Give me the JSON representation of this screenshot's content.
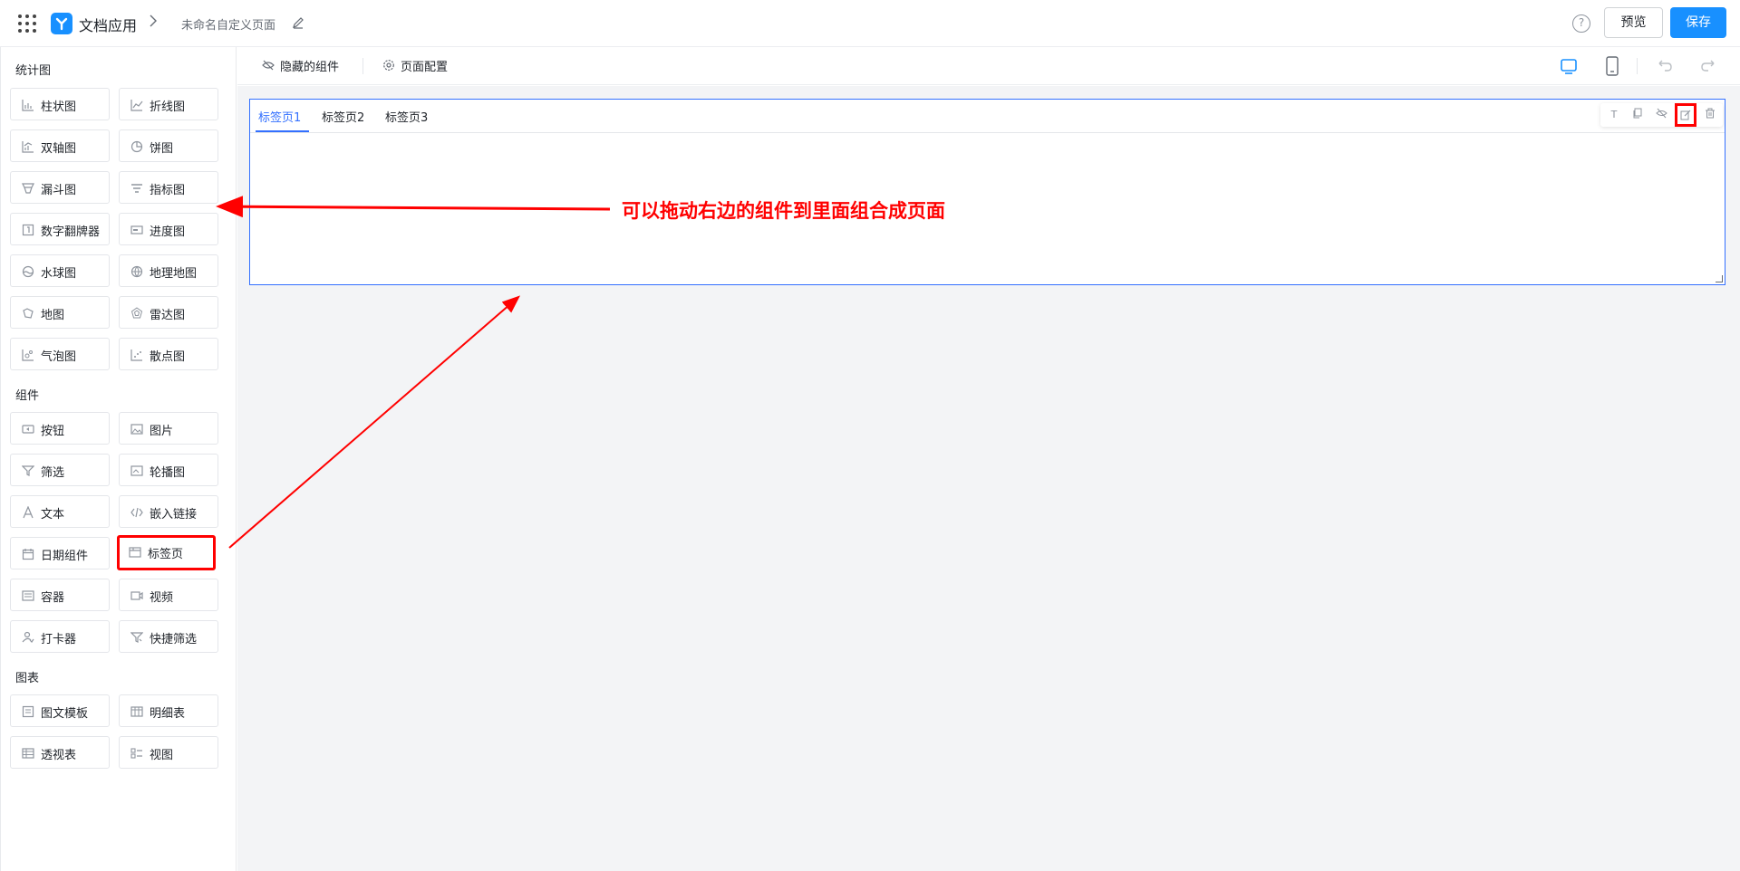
{
  "header": {
    "app_title": "文档应用",
    "page_name": "未命名自定义页面",
    "help_label": "?",
    "preview_label": "预览",
    "save_label": "保存",
    "brand_color": "#1890ff"
  },
  "sidebar": {
    "sections": [
      {
        "title": "统计图",
        "items": [
          {
            "label": "柱状图",
            "icon": "bar-chart-icon"
          },
          {
            "label": "折线图",
            "icon": "line-chart-icon"
          },
          {
            "label": "双轴图",
            "icon": "dual-axis-icon"
          },
          {
            "label": "饼图",
            "icon": "pie-chart-icon"
          },
          {
            "label": "漏斗图",
            "icon": "funnel-icon"
          },
          {
            "label": "指标图",
            "icon": "indicator-icon"
          },
          {
            "label": "数字翻牌器",
            "icon": "number-flip-icon"
          },
          {
            "label": "进度图",
            "icon": "progress-icon"
          },
          {
            "label": "水球图",
            "icon": "liquid-icon"
          },
          {
            "label": "地理地图",
            "icon": "globe-icon"
          },
          {
            "label": "地图",
            "icon": "map-icon"
          },
          {
            "label": "雷达图",
            "icon": "radar-icon"
          },
          {
            "label": "气泡图",
            "icon": "bubble-icon"
          },
          {
            "label": "散点图",
            "icon": "scatter-icon"
          }
        ]
      },
      {
        "title": "组件",
        "items": [
          {
            "label": "按钮",
            "icon": "button-icon"
          },
          {
            "label": "图片",
            "icon": "image-icon"
          },
          {
            "label": "筛选",
            "icon": "filter-icon"
          },
          {
            "label": "轮播图",
            "icon": "carousel-icon"
          },
          {
            "label": "文本",
            "icon": "text-icon"
          },
          {
            "label": "嵌入链接",
            "icon": "code-icon"
          },
          {
            "label": "日期组件",
            "icon": "calendar-icon"
          },
          {
            "label": "标签页",
            "icon": "tabs-icon",
            "highlighted": true
          },
          {
            "label": "容器",
            "icon": "container-icon"
          },
          {
            "label": "视频",
            "icon": "video-icon"
          },
          {
            "label": "打卡器",
            "icon": "checkin-icon"
          },
          {
            "label": "快捷筛选",
            "icon": "quick-filter-icon"
          }
        ]
      },
      {
        "title": "图表",
        "items": [
          {
            "label": "图文模板",
            "icon": "template-icon"
          },
          {
            "label": "明细表",
            "icon": "detail-table-icon"
          },
          {
            "label": "透视表",
            "icon": "pivot-table-icon"
          },
          {
            "label": "视图",
            "icon": "view-icon"
          }
        ]
      }
    ]
  },
  "toolbar": {
    "hidden_components_label": "隐藏的组件",
    "page_config_label": "页面配置",
    "active_device": "desktop"
  },
  "canvas": {
    "tabs": [
      {
        "label": "标签页1",
        "active": true
      },
      {
        "label": "标签页2",
        "active": false
      },
      {
        "label": "标签页3",
        "active": false
      }
    ],
    "component_tools": [
      {
        "icon": "text-icon",
        "glyph": "T"
      },
      {
        "icon": "copy-icon"
      },
      {
        "icon": "hide-icon"
      },
      {
        "icon": "edit-icon",
        "highlighted": true
      },
      {
        "icon": "delete-icon"
      }
    ],
    "accent_color": "#3370ff"
  },
  "annotation": {
    "text": "可以拖动右边的组件到里面组合成页面",
    "color": "#ff0000"
  }
}
